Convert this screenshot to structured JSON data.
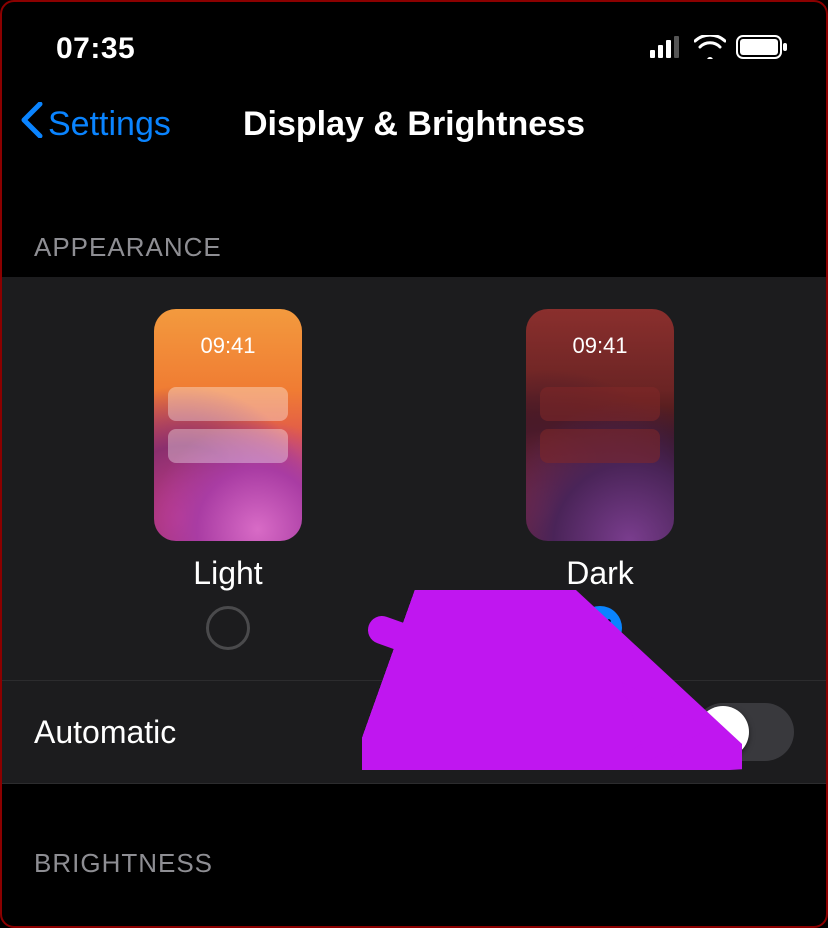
{
  "status_bar": {
    "time": "07:35"
  },
  "nav": {
    "back_label": "Settings",
    "title": "Display & Brightness"
  },
  "sections": {
    "appearance": {
      "header": "APPEARANCE",
      "options": [
        {
          "label": "Light",
          "preview_time": "09:41",
          "selected": false
        },
        {
          "label": "Dark",
          "preview_time": "09:41",
          "selected": true
        }
      ],
      "automatic": {
        "label": "Automatic",
        "enabled": false
      }
    },
    "brightness": {
      "header": "BRIGHTNESS"
    }
  }
}
